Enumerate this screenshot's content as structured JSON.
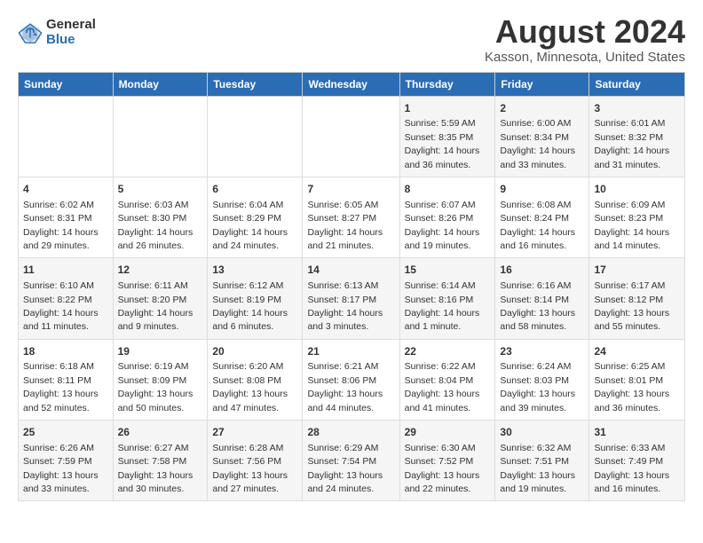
{
  "logo": {
    "general": "General",
    "blue": "Blue"
  },
  "title": "August 2024",
  "subtitle": "Kasson, Minnesota, United States",
  "days_of_week": [
    "Sunday",
    "Monday",
    "Tuesday",
    "Wednesday",
    "Thursday",
    "Friday",
    "Saturday"
  ],
  "weeks": [
    [
      {
        "day": "",
        "info": ""
      },
      {
        "day": "",
        "info": ""
      },
      {
        "day": "",
        "info": ""
      },
      {
        "day": "",
        "info": ""
      },
      {
        "day": "1",
        "info": "Sunrise: 5:59 AM\nSunset: 8:35 PM\nDaylight: 14 hours and 36 minutes."
      },
      {
        "day": "2",
        "info": "Sunrise: 6:00 AM\nSunset: 8:34 PM\nDaylight: 14 hours and 33 minutes."
      },
      {
        "day": "3",
        "info": "Sunrise: 6:01 AM\nSunset: 8:32 PM\nDaylight: 14 hours and 31 minutes."
      }
    ],
    [
      {
        "day": "4",
        "info": "Sunrise: 6:02 AM\nSunset: 8:31 PM\nDaylight: 14 hours and 29 minutes."
      },
      {
        "day": "5",
        "info": "Sunrise: 6:03 AM\nSunset: 8:30 PM\nDaylight: 14 hours and 26 minutes."
      },
      {
        "day": "6",
        "info": "Sunrise: 6:04 AM\nSunset: 8:29 PM\nDaylight: 14 hours and 24 minutes."
      },
      {
        "day": "7",
        "info": "Sunrise: 6:05 AM\nSunset: 8:27 PM\nDaylight: 14 hours and 21 minutes."
      },
      {
        "day": "8",
        "info": "Sunrise: 6:07 AM\nSunset: 8:26 PM\nDaylight: 14 hours and 19 minutes."
      },
      {
        "day": "9",
        "info": "Sunrise: 6:08 AM\nSunset: 8:24 PM\nDaylight: 14 hours and 16 minutes."
      },
      {
        "day": "10",
        "info": "Sunrise: 6:09 AM\nSunset: 8:23 PM\nDaylight: 14 hours and 14 minutes."
      }
    ],
    [
      {
        "day": "11",
        "info": "Sunrise: 6:10 AM\nSunset: 8:22 PM\nDaylight: 14 hours and 11 minutes."
      },
      {
        "day": "12",
        "info": "Sunrise: 6:11 AM\nSunset: 8:20 PM\nDaylight: 14 hours and 9 minutes."
      },
      {
        "day": "13",
        "info": "Sunrise: 6:12 AM\nSunset: 8:19 PM\nDaylight: 14 hours and 6 minutes."
      },
      {
        "day": "14",
        "info": "Sunrise: 6:13 AM\nSunset: 8:17 PM\nDaylight: 14 hours and 3 minutes."
      },
      {
        "day": "15",
        "info": "Sunrise: 6:14 AM\nSunset: 8:16 PM\nDaylight: 14 hours and 1 minute."
      },
      {
        "day": "16",
        "info": "Sunrise: 6:16 AM\nSunset: 8:14 PM\nDaylight: 13 hours and 58 minutes."
      },
      {
        "day": "17",
        "info": "Sunrise: 6:17 AM\nSunset: 8:12 PM\nDaylight: 13 hours and 55 minutes."
      }
    ],
    [
      {
        "day": "18",
        "info": "Sunrise: 6:18 AM\nSunset: 8:11 PM\nDaylight: 13 hours and 52 minutes."
      },
      {
        "day": "19",
        "info": "Sunrise: 6:19 AM\nSunset: 8:09 PM\nDaylight: 13 hours and 50 minutes."
      },
      {
        "day": "20",
        "info": "Sunrise: 6:20 AM\nSunset: 8:08 PM\nDaylight: 13 hours and 47 minutes."
      },
      {
        "day": "21",
        "info": "Sunrise: 6:21 AM\nSunset: 8:06 PM\nDaylight: 13 hours and 44 minutes."
      },
      {
        "day": "22",
        "info": "Sunrise: 6:22 AM\nSunset: 8:04 PM\nDaylight: 13 hours and 41 minutes."
      },
      {
        "day": "23",
        "info": "Sunrise: 6:24 AM\nSunset: 8:03 PM\nDaylight: 13 hours and 39 minutes."
      },
      {
        "day": "24",
        "info": "Sunrise: 6:25 AM\nSunset: 8:01 PM\nDaylight: 13 hours and 36 minutes."
      }
    ],
    [
      {
        "day": "25",
        "info": "Sunrise: 6:26 AM\nSunset: 7:59 PM\nDaylight: 13 hours and 33 minutes."
      },
      {
        "day": "26",
        "info": "Sunrise: 6:27 AM\nSunset: 7:58 PM\nDaylight: 13 hours and 30 minutes."
      },
      {
        "day": "27",
        "info": "Sunrise: 6:28 AM\nSunset: 7:56 PM\nDaylight: 13 hours and 27 minutes."
      },
      {
        "day": "28",
        "info": "Sunrise: 6:29 AM\nSunset: 7:54 PM\nDaylight: 13 hours and 24 minutes."
      },
      {
        "day": "29",
        "info": "Sunrise: 6:30 AM\nSunset: 7:52 PM\nDaylight: 13 hours and 22 minutes."
      },
      {
        "day": "30",
        "info": "Sunrise: 6:32 AM\nSunset: 7:51 PM\nDaylight: 13 hours and 19 minutes."
      },
      {
        "day": "31",
        "info": "Sunrise: 6:33 AM\nSunset: 7:49 PM\nDaylight: 13 hours and 16 minutes."
      }
    ]
  ]
}
